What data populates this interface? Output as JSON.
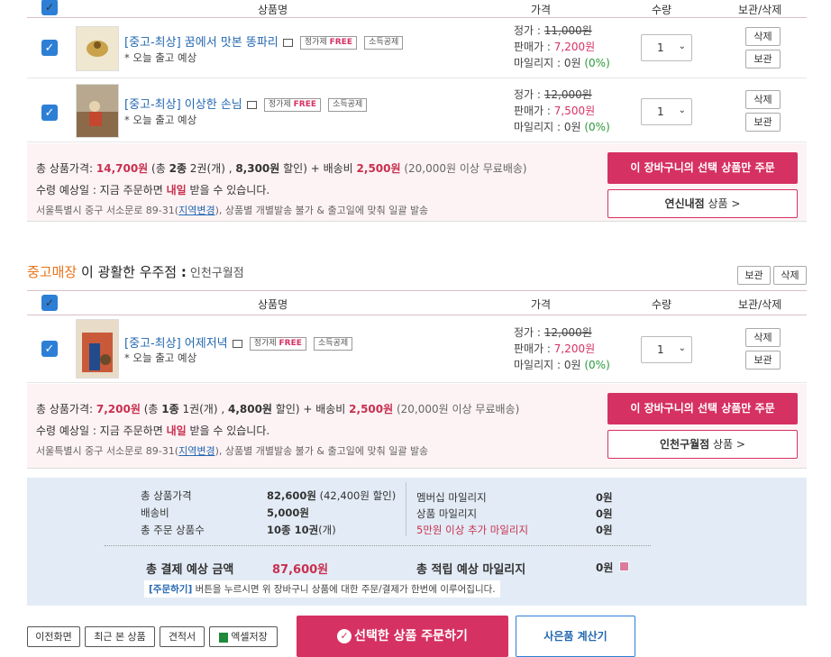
{
  "table_header": {
    "checkbox": "✓",
    "product": "상품명",
    "price": "가격",
    "qty": "수량",
    "action": "보관/삭제"
  },
  "group1": {
    "items": [
      {
        "title": "[중고-최상] 꿈에서 맛본 똥파리",
        "tag1_prefix": "정가제",
        "tag1_free": "FREE",
        "tag2": "소득공제",
        "ship": "* 오늘 출고 예상",
        "list_label": "정가 : ",
        "list_price": "11,000원",
        "sale_label": "판매가 : ",
        "sale_price": "7,200원",
        "mile_label": "마일리지 : ",
        "mile": "0원",
        "mile_pct": "(0%)",
        "qty": "1",
        "delete": "삭제",
        "keep": "보관"
      },
      {
        "title": "[중고-최상] 이상한 손님",
        "tag1_prefix": "정가제",
        "tag1_free": "FREE",
        "tag2": "소득공제",
        "ship": "* 오늘 출고 예상",
        "list_label": "정가 : ",
        "list_price": "12,000원",
        "sale_label": "판매가 : ",
        "sale_price": "7,500원",
        "mile_label": "마일리지 : ",
        "mile": "0원",
        "mile_pct": "(0%)",
        "qty": "1",
        "delete": "삭제",
        "keep": "보관"
      }
    ],
    "summary": {
      "a": "총 상품가격: ",
      "total": "14,700원",
      "b": " (총 ",
      "kinds": "2종",
      "c": " 2권(개) , ",
      "disc": "8,300원",
      "d": " 할인) + 배송비 ",
      "ship_fee": "2,500원",
      "e": " (20,000원 이상 무료배송)",
      "recv1": "수령 예상일 : 지금 주문하면 ",
      "recv_day": "내일",
      "recv2": " 받을 수 있습니다.",
      "addr1": "서울특별시 중구 서소문로 89-31(",
      "addr_link": "지역변경",
      "addr2": "), 상품별 개별발송 불가 & 출고일에 맞춰 일괄 발송",
      "order_btn": "이 장바구니의 선택 상품만 주문",
      "store_name": "연신내점",
      "store_suffix": " 상품 >"
    }
  },
  "group2": {
    "store_prefix": "중고매장",
    "store_mid": " 이 광활한 우주점 ",
    "store_colon": ":",
    "store_sub": "인천구월점",
    "keep_all": "보관",
    "delete_all": "삭제",
    "items": [
      {
        "title": "[중고-최상] 어제저녁",
        "tag1_prefix": "정가제",
        "tag1_free": "FREE",
        "tag2": "소득공제",
        "ship": "* 오늘 출고 예상",
        "list_label": "정가 : ",
        "list_price": "12,000원",
        "sale_label": "판매가 : ",
        "sale_price": "7,200원",
        "mile_label": "마일리지 : ",
        "mile": "0원",
        "mile_pct": "(0%)",
        "qty": "1",
        "delete": "삭제",
        "keep": "보관"
      }
    ],
    "summary": {
      "a": "총 상품가격: ",
      "total": "7,200원",
      "b": " (총 ",
      "kinds": "1종",
      "c": " 1권(개) , ",
      "disc": "4,800원",
      "d": " 할인) + 배송비 ",
      "ship_fee": "2,500원",
      "e": " (20,000원 이상 무료배송)",
      "recv1": "수령 예상일 : 지금 주문하면 ",
      "recv_day": "내일",
      "recv2": " 받을 수 있습니다.",
      "addr1": "서울특별시 중구 서소문로 89-31(",
      "addr_link": "지역변경",
      "addr2": "), 상품별 개별발송 불가 & 출고일에 맞춰 일괄 발송",
      "order_btn": "이 장바구니의 선택 상품만 주문",
      "store_name": "인천구월점",
      "store_suffix": " 상품 >"
    }
  },
  "totals": {
    "k1": "총 상품가격",
    "v1": "82,600원",
    "v1b": " (42,400원 할인)",
    "k2": "배송비",
    "v2": "5,000원",
    "k3": "총 주문 상품수",
    "v3": "10종 10권",
    "v3b": "(개)",
    "k4": "멤버십 마일리지",
    "v4": "0원",
    "k5": "상품 마일리지",
    "v5": "0원",
    "k6": "5만원 이상 추가 마일리지",
    "v6": "0원",
    "pay_label": "총 결제 예상 금액",
    "pay_value": "87,600원",
    "earn_label": "총 적립 예상 마일리지",
    "earn_value": "0원",
    "note_link": "[주문하기]",
    "note_text": " 버튼을 누르시면 위 장바구니 상품에 대한 주문/결제가 한번에 이루어집니다."
  },
  "bottom": {
    "prev": "이전화면",
    "recent": "최근 본 상품",
    "quote": "견적서",
    "excel": "엑셀저장",
    "order_main": "선택한 상품 주문하기",
    "gift_calc": "사은품 계산기"
  },
  "colors": {
    "accent": "#d63163",
    "link": "#2468b0",
    "checkbox": "#2d7fd6",
    "orange": "#e8731a"
  }
}
